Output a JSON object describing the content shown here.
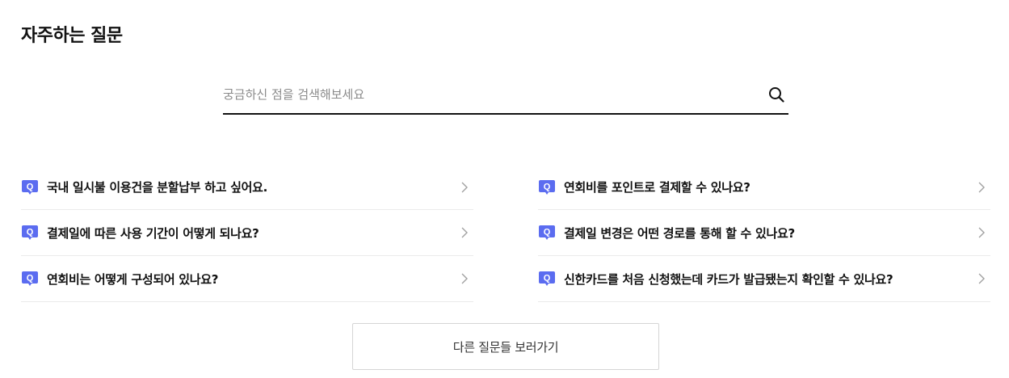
{
  "section": {
    "title": "자주하는 질문"
  },
  "search": {
    "placeholder": "궁금하신 점을 검색해보세요",
    "value": "",
    "icon": "search-icon"
  },
  "faq": {
    "badge_letter": "Q",
    "badge_color": "#5b6cf0",
    "left": [
      {
        "question": "국내 일시불 이용건을 분할납부 하고 싶어요."
      },
      {
        "question": "결제일에 따른 사용 기간이 어떻게 되나요?"
      },
      {
        "question": "연회비는 어떻게 구성되어 있나요?"
      }
    ],
    "right": [
      {
        "question": "연회비를 포인트로 결제할 수 있나요?"
      },
      {
        "question": "결제일 변경은 어떤 경로를 통해 할 수 있나요?"
      },
      {
        "question": "신한카드를 처음 신청했는데 카드가 발급됐는지 확인할 수 있나요?"
      }
    ]
  },
  "more_button": {
    "label": "다른 질문들 보러가기"
  }
}
